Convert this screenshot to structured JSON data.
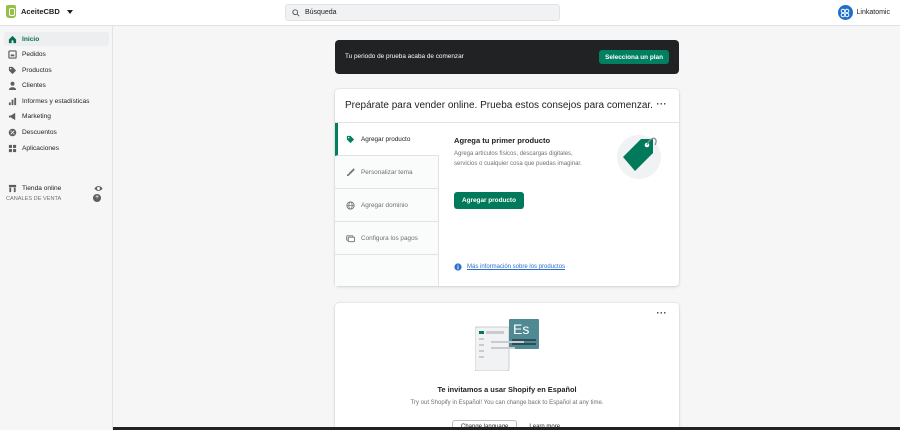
{
  "topbar": {
    "store_name": "AceiteCBD",
    "search_placeholder": "Búsqueda",
    "user_name": "Linkatomic"
  },
  "sidebar": {
    "items": [
      {
        "label": "Inicio",
        "icon": "home-icon",
        "active": true
      },
      {
        "label": "Pedidos",
        "icon": "orders-icon"
      },
      {
        "label": "Productos",
        "icon": "tag-icon"
      },
      {
        "label": "Clientes",
        "icon": "person-icon"
      },
      {
        "label": "Informes y estadísticas",
        "icon": "bar-chart-icon"
      },
      {
        "label": "Marketing",
        "icon": "megaphone-icon"
      },
      {
        "label": "Descuentos",
        "icon": "discount-icon"
      },
      {
        "label": "Aplicaciones",
        "icon": "apps-icon"
      }
    ],
    "sales_channels_title": "CANALES DE VENTA",
    "online_store_label": "Tienda online"
  },
  "banner": {
    "text": "Tu periodo de prueba acaba de comenzar",
    "button_label": "Selecciona un plan"
  },
  "setup_card": {
    "title": "Prepárate para vender online. Prueba estos consejos para comenzar.",
    "tabs": [
      {
        "label": "Agregar producto",
        "icon": "tag-icon",
        "active": true
      },
      {
        "label": "Personalizar tema",
        "icon": "brush-icon"
      },
      {
        "label": "Agregar dominio",
        "icon": "globe-icon"
      },
      {
        "label": "Configura los pagos",
        "icon": "payment-icon"
      }
    ],
    "pane": {
      "title": "Agrega tu primer producto",
      "description": "Agrega artículos físicos, descargas digitales, servicios o cualquier cosa que puedas imaginar.",
      "button_label": "Agregar producto",
      "link_label": "Más información sobre los productos"
    }
  },
  "language_card": {
    "illustration_text": "Es",
    "title": "Te invitamos a usar Shopify en Español",
    "description": "Try out Shopify in Español! You can change back to Español at any time.",
    "change_button": "Change language",
    "learn_more": "Learn more"
  },
  "colors": {
    "accent": "#008060",
    "banner": "#202223",
    "link": "#2c6ecb"
  }
}
